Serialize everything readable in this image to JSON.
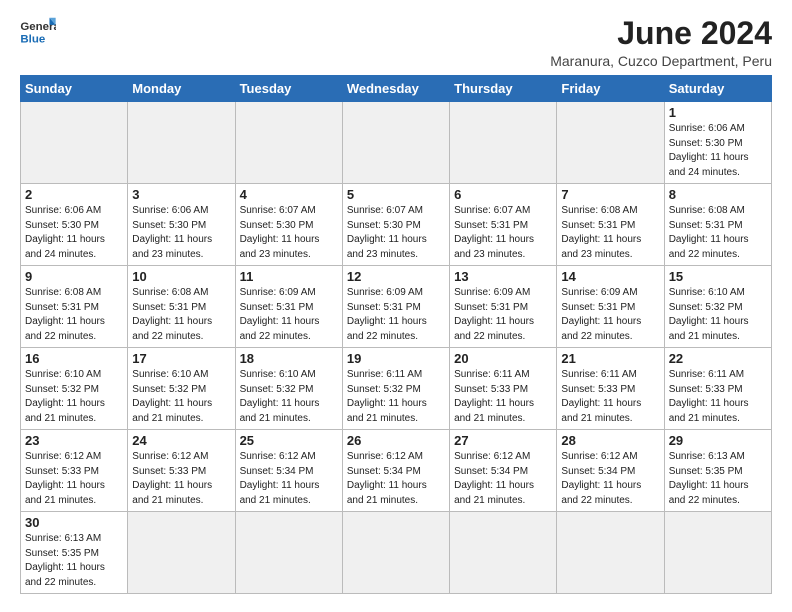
{
  "header": {
    "logo_general": "General",
    "logo_blue": "Blue",
    "month_year": "June 2024",
    "location": "Maranura, Cuzco Department, Peru"
  },
  "days_of_week": [
    "Sunday",
    "Monday",
    "Tuesday",
    "Wednesday",
    "Thursday",
    "Friday",
    "Saturday"
  ],
  "weeks": [
    [
      {
        "day": "",
        "info": ""
      },
      {
        "day": "",
        "info": ""
      },
      {
        "day": "",
        "info": ""
      },
      {
        "day": "",
        "info": ""
      },
      {
        "day": "",
        "info": ""
      },
      {
        "day": "",
        "info": ""
      },
      {
        "day": "1",
        "info": "Sunrise: 6:06 AM\nSunset: 5:30 PM\nDaylight: 11 hours\nand 24 minutes."
      }
    ],
    [
      {
        "day": "2",
        "info": "Sunrise: 6:06 AM\nSunset: 5:30 PM\nDaylight: 11 hours\nand 24 minutes."
      },
      {
        "day": "3",
        "info": "Sunrise: 6:06 AM\nSunset: 5:30 PM\nDaylight: 11 hours\nand 23 minutes."
      },
      {
        "day": "4",
        "info": "Sunrise: 6:07 AM\nSunset: 5:30 PM\nDaylight: 11 hours\nand 23 minutes."
      },
      {
        "day": "5",
        "info": "Sunrise: 6:07 AM\nSunset: 5:30 PM\nDaylight: 11 hours\nand 23 minutes."
      },
      {
        "day": "6",
        "info": "Sunrise: 6:07 AM\nSunset: 5:31 PM\nDaylight: 11 hours\nand 23 minutes."
      },
      {
        "day": "7",
        "info": "Sunrise: 6:08 AM\nSunset: 5:31 PM\nDaylight: 11 hours\nand 23 minutes."
      },
      {
        "day": "8",
        "info": "Sunrise: 6:08 AM\nSunset: 5:31 PM\nDaylight: 11 hours\nand 22 minutes."
      }
    ],
    [
      {
        "day": "9",
        "info": "Sunrise: 6:08 AM\nSunset: 5:31 PM\nDaylight: 11 hours\nand 22 minutes."
      },
      {
        "day": "10",
        "info": "Sunrise: 6:08 AM\nSunset: 5:31 PM\nDaylight: 11 hours\nand 22 minutes."
      },
      {
        "day": "11",
        "info": "Sunrise: 6:09 AM\nSunset: 5:31 PM\nDaylight: 11 hours\nand 22 minutes."
      },
      {
        "day": "12",
        "info": "Sunrise: 6:09 AM\nSunset: 5:31 PM\nDaylight: 11 hours\nand 22 minutes."
      },
      {
        "day": "13",
        "info": "Sunrise: 6:09 AM\nSunset: 5:31 PM\nDaylight: 11 hours\nand 22 minutes."
      },
      {
        "day": "14",
        "info": "Sunrise: 6:09 AM\nSunset: 5:31 PM\nDaylight: 11 hours\nand 22 minutes."
      },
      {
        "day": "15",
        "info": "Sunrise: 6:10 AM\nSunset: 5:32 PM\nDaylight: 11 hours\nand 21 minutes."
      }
    ],
    [
      {
        "day": "16",
        "info": "Sunrise: 6:10 AM\nSunset: 5:32 PM\nDaylight: 11 hours\nand 21 minutes."
      },
      {
        "day": "17",
        "info": "Sunrise: 6:10 AM\nSunset: 5:32 PM\nDaylight: 11 hours\nand 21 minutes."
      },
      {
        "day": "18",
        "info": "Sunrise: 6:10 AM\nSunset: 5:32 PM\nDaylight: 11 hours\nand 21 minutes."
      },
      {
        "day": "19",
        "info": "Sunrise: 6:11 AM\nSunset: 5:32 PM\nDaylight: 11 hours\nand 21 minutes."
      },
      {
        "day": "20",
        "info": "Sunrise: 6:11 AM\nSunset: 5:33 PM\nDaylight: 11 hours\nand 21 minutes."
      },
      {
        "day": "21",
        "info": "Sunrise: 6:11 AM\nSunset: 5:33 PM\nDaylight: 11 hours\nand 21 minutes."
      },
      {
        "day": "22",
        "info": "Sunrise: 6:11 AM\nSunset: 5:33 PM\nDaylight: 11 hours\nand 21 minutes."
      }
    ],
    [
      {
        "day": "23",
        "info": "Sunrise: 6:12 AM\nSunset: 5:33 PM\nDaylight: 11 hours\nand 21 minutes."
      },
      {
        "day": "24",
        "info": "Sunrise: 6:12 AM\nSunset: 5:33 PM\nDaylight: 11 hours\nand 21 minutes."
      },
      {
        "day": "25",
        "info": "Sunrise: 6:12 AM\nSunset: 5:34 PM\nDaylight: 11 hours\nand 21 minutes."
      },
      {
        "day": "26",
        "info": "Sunrise: 6:12 AM\nSunset: 5:34 PM\nDaylight: 11 hours\nand 21 minutes."
      },
      {
        "day": "27",
        "info": "Sunrise: 6:12 AM\nSunset: 5:34 PM\nDaylight: 11 hours\nand 21 minutes."
      },
      {
        "day": "28",
        "info": "Sunrise: 6:12 AM\nSunset: 5:34 PM\nDaylight: 11 hours\nand 22 minutes."
      },
      {
        "day": "29",
        "info": "Sunrise: 6:13 AM\nSunset: 5:35 PM\nDaylight: 11 hours\nand 22 minutes."
      }
    ],
    [
      {
        "day": "30",
        "info": "Sunrise: 6:13 AM\nSunset: 5:35 PM\nDaylight: 11 hours\nand 22 minutes."
      },
      {
        "day": "",
        "info": ""
      },
      {
        "day": "",
        "info": ""
      },
      {
        "day": "",
        "info": ""
      },
      {
        "day": "",
        "info": ""
      },
      {
        "day": "",
        "info": ""
      },
      {
        "day": "",
        "info": ""
      }
    ]
  ]
}
